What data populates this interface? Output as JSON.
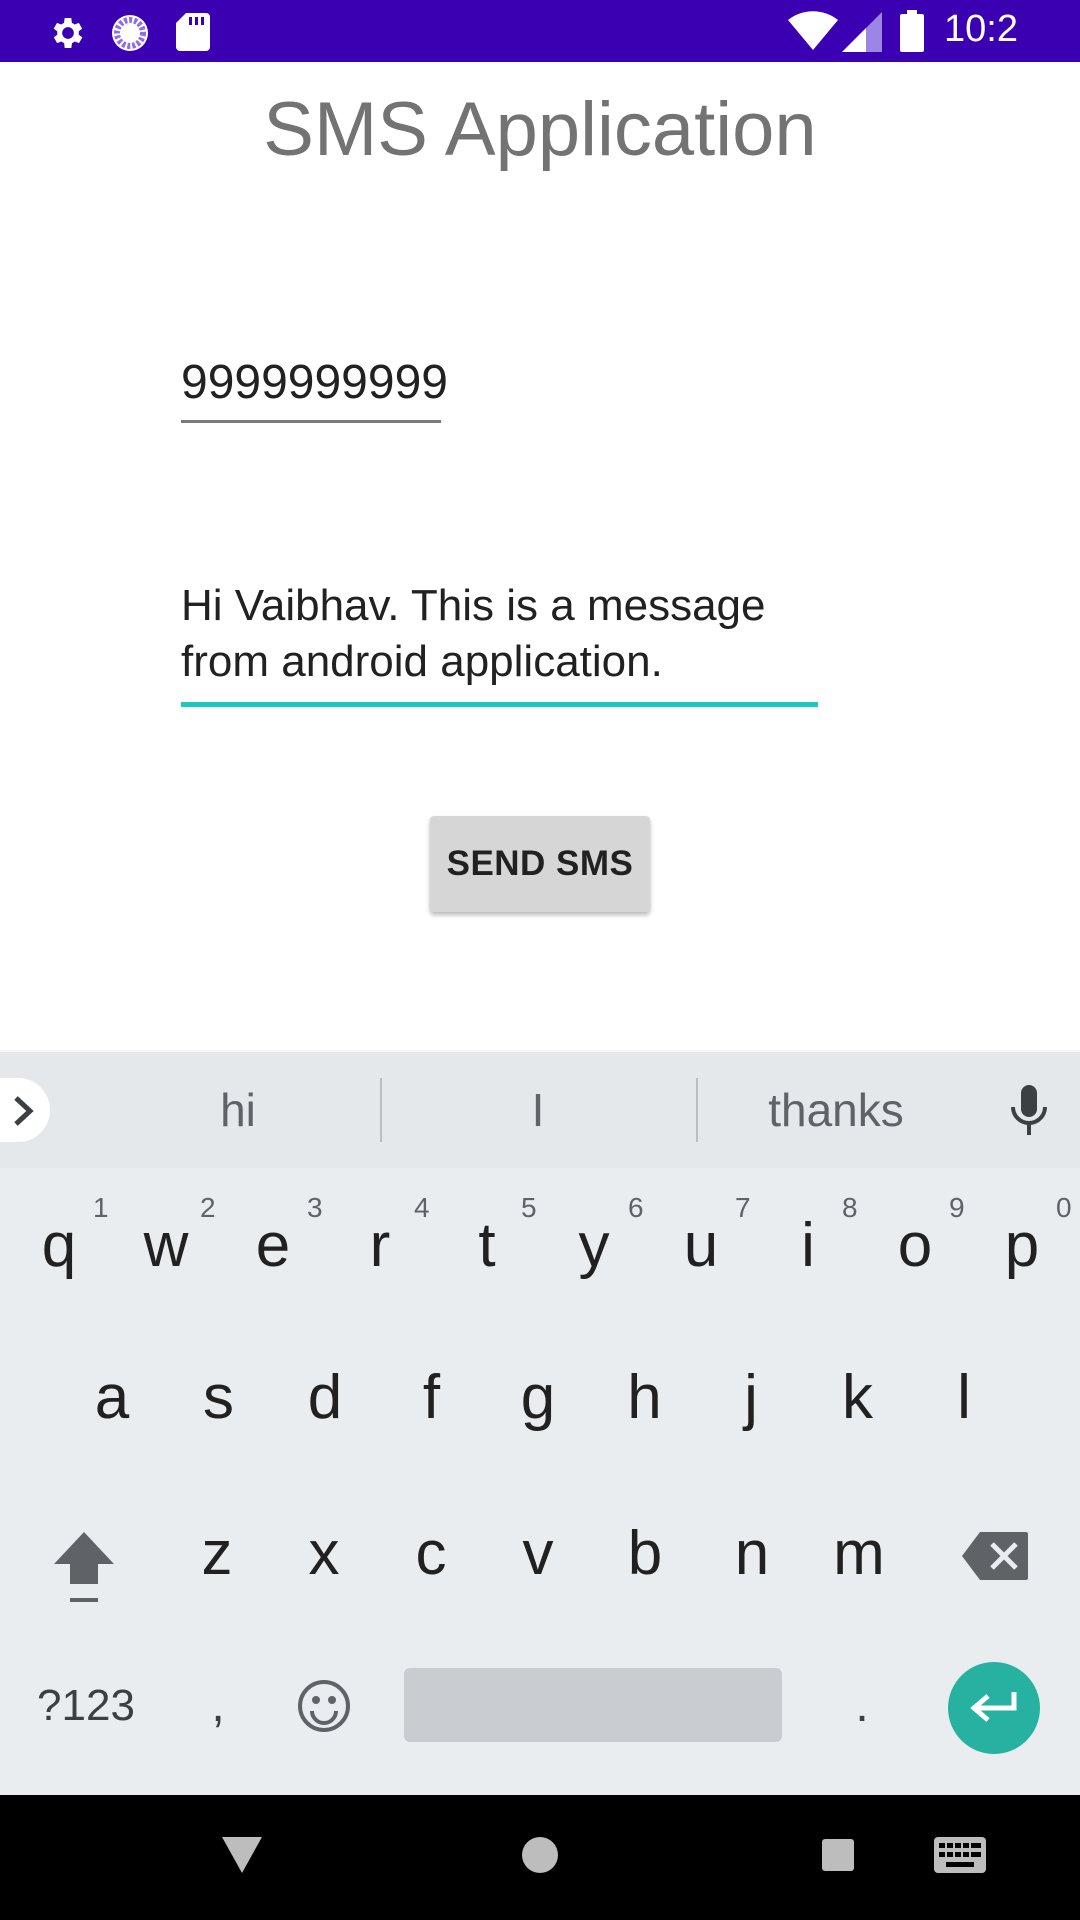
{
  "status_bar": {
    "time": "10:2",
    "icons": [
      "settings-icon",
      "sync-icon",
      "sd-card-icon",
      "wifi-icon",
      "cell-signal-icon",
      "battery-icon"
    ],
    "background": "#3a00b2"
  },
  "app": {
    "title": "SMS Application",
    "phone_value": "9999999999",
    "message_value": "Hi Vaibhav. This is a message from android application.",
    "send_label": "SEND SMS",
    "accent_color": "#1cc8c0"
  },
  "keyboard": {
    "suggestions": [
      "hi",
      "I",
      "thanks"
    ],
    "row1": [
      "q",
      "w",
      "e",
      "r",
      "t",
      "y",
      "u",
      "i",
      "o",
      "p"
    ],
    "row1_hints": [
      "1",
      "2",
      "3",
      "4",
      "5",
      "6",
      "7",
      "8",
      "9",
      "0"
    ],
    "row2": [
      "a",
      "s",
      "d",
      "f",
      "g",
      "h",
      "j",
      "k",
      "l"
    ],
    "row3": [
      "z",
      "x",
      "c",
      "v",
      "b",
      "n",
      "m"
    ],
    "symbols_label": "?123",
    "comma": ",",
    "period": ".",
    "enter_color": "#26b1a0"
  },
  "nav_bar": {
    "buttons": [
      "back-icon",
      "home-icon",
      "recents-icon",
      "keyboard-switch-icon"
    ]
  }
}
